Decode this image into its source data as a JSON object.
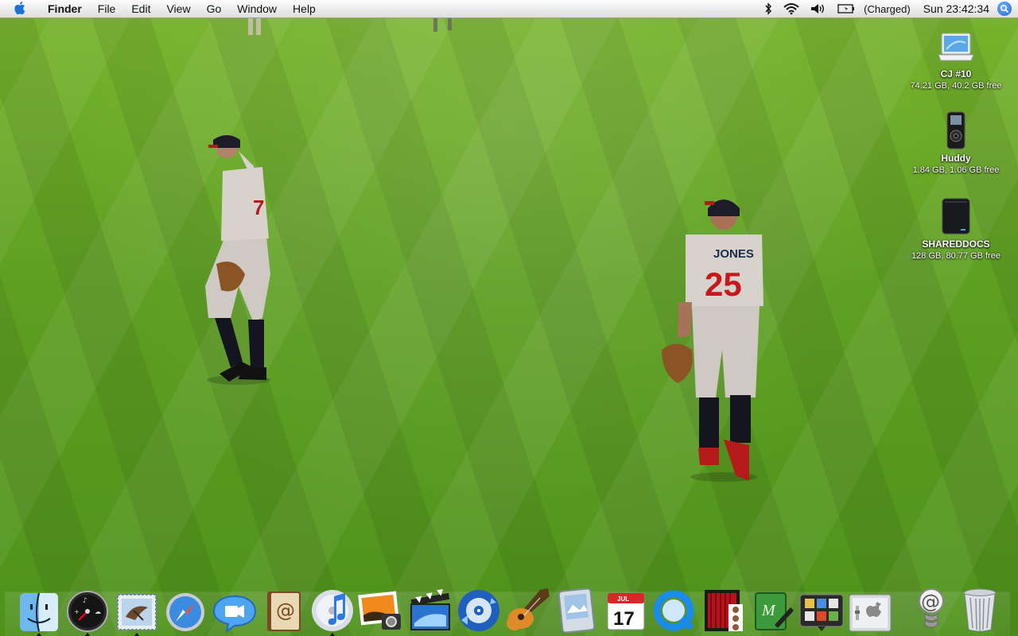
{
  "menubar": {
    "apple_icon": "apple-icon",
    "app_name": "Finder",
    "menus": [
      "File",
      "Edit",
      "View",
      "Go",
      "Window",
      "Help"
    ],
    "status_icons": [
      "bluetooth-icon",
      "wifi-icon",
      "volume-icon",
      "battery-icon"
    ],
    "battery_status": "(Charged)",
    "clock": "Sun 23:42:34",
    "spotlight_icon": "spotlight-icon"
  },
  "desktop": {
    "wallpaper": "baseball outfield photo",
    "icons": [
      {
        "name": "CJ #10",
        "info": "74.21 GB, 40.2 GB free",
        "icon": "laptop-icon"
      },
      {
        "name": "Huddy",
        "info": "1.84 GB, 1.06 GB free",
        "icon": "ipod-nano-icon"
      },
      {
        "name": "SHAREDDOCS",
        "info": "128 GB, 80.77 GB free",
        "icon": "external-drive-icon"
      }
    ]
  },
  "dock": {
    "apps": [
      {
        "icon": "finder-icon",
        "running": true
      },
      {
        "icon": "dashboard-icon",
        "running": true
      },
      {
        "icon": "mail-icon",
        "running": true
      },
      {
        "icon": "safari-icon",
        "running": false
      },
      {
        "icon": "ichat-icon",
        "running": false
      },
      {
        "icon": "address-book-icon",
        "running": false
      },
      {
        "icon": "itunes-icon",
        "running": true
      },
      {
        "icon": "iphoto-icon",
        "running": false
      },
      {
        "icon": "imovie-icon",
        "running": false
      },
      {
        "icon": "idvd-icon",
        "running": false
      },
      {
        "icon": "garageband-icon",
        "running": false
      },
      {
        "icon": "preview-icon",
        "running": false
      },
      {
        "icon": "ical-icon",
        "running": false,
        "date": "17",
        "month": "JUL"
      },
      {
        "icon": "quicktime-icon",
        "running": false
      },
      {
        "icon": "photo-booth-icon",
        "running": false
      },
      {
        "icon": "script-editor-icon",
        "running": false
      },
      {
        "icon": "front-row-icon",
        "running": false
      },
      {
        "icon": "system-preferences-icon",
        "running": false
      }
    ],
    "right": [
      {
        "icon": "mail-stack-icon"
      },
      {
        "icon": "trash-icon"
      }
    ]
  },
  "colors": {
    "grass_light": "#78b52d",
    "grass_dark": "#4f921b",
    "menubar_bg": "#ececec",
    "spotlight": "#1f66d6"
  }
}
